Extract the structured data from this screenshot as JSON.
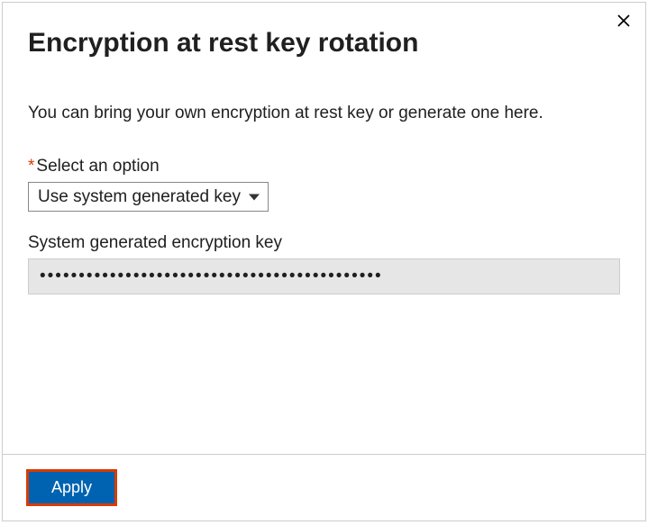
{
  "dialog": {
    "title": "Encryption at rest key rotation",
    "description": "You can bring your own encryption at rest key or generate one here.",
    "close_icon": "close"
  },
  "option_field": {
    "required_mark": "*",
    "label": "Select an option",
    "selected": "Use system generated key"
  },
  "key_field": {
    "label": "System generated encryption key",
    "value": "••••••••••••••••••••••••••••••••••••••••••••"
  },
  "footer": {
    "apply_label": "Apply"
  }
}
